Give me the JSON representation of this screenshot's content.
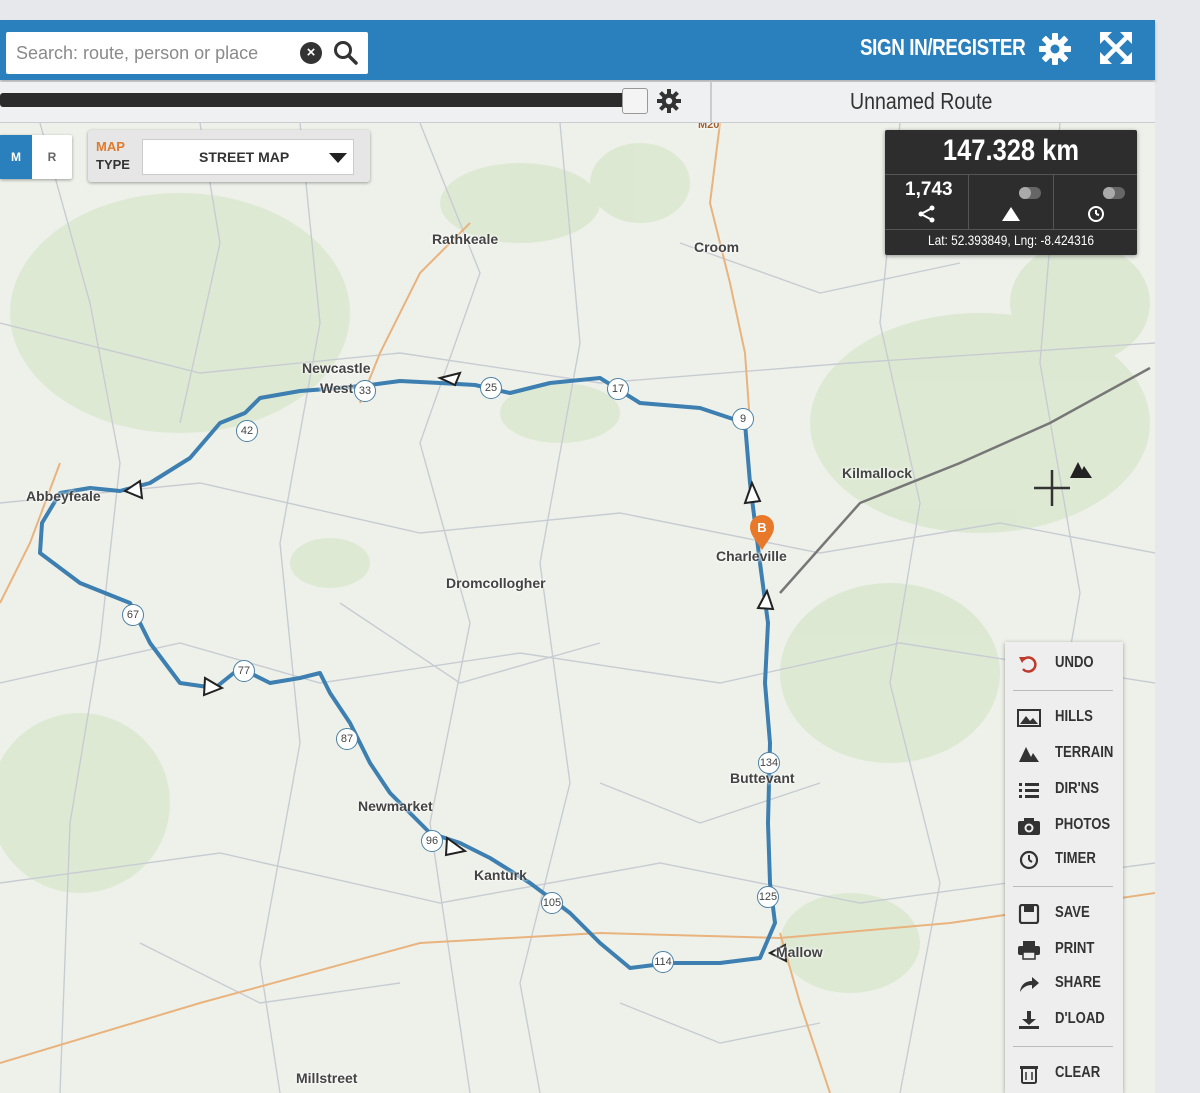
{
  "header": {
    "search_placeholder": "Search: route, person or place",
    "signin_label": "SIGN IN/REGISTER",
    "settings_icon": "gear-icon",
    "fullscreen_icon": "fullscreen-icon"
  },
  "subbar": {
    "route_name": "Unnamed Route"
  },
  "map_type": {
    "toggle_m": "M",
    "toggle_r": "R",
    "label_line1": "MAP",
    "label_line2": "TYPE",
    "selected": "STREET MAP"
  },
  "stats": {
    "distance": "147.328 km",
    "climb": "1,743",
    "coords": "Lat: 52.393849, Lng: -8.424316"
  },
  "map": {
    "places": [
      "Rathkeale",
      "Croom",
      "Newcastle",
      "West",
      "Kilmallock",
      "Abbeyfeale",
      "Charleville",
      "Dromcollogher",
      "Buttevant",
      "Newmarket",
      "Kanturk",
      "Mallow",
      "Millstreet"
    ],
    "road_label": "M20",
    "distance_markers": [
      "9",
      "17",
      "25",
      "33",
      "42",
      "67",
      "77",
      "87",
      "96",
      "105",
      "114",
      "125",
      "134"
    ],
    "end_marker": "B",
    "accent_route": "#3d7fb0",
    "accent_marker": "#e8782a"
  },
  "side_menu": {
    "undo": "UNDO",
    "hills": "HILLS",
    "terrain": "TERRAIN",
    "dirns": "DIR'NS",
    "photos": "PHOTOS",
    "timer": "TIMER",
    "save": "SAVE",
    "print": "PRINT",
    "share": "SHARE",
    "dload": "D'LOAD",
    "clear": "CLEAR"
  }
}
